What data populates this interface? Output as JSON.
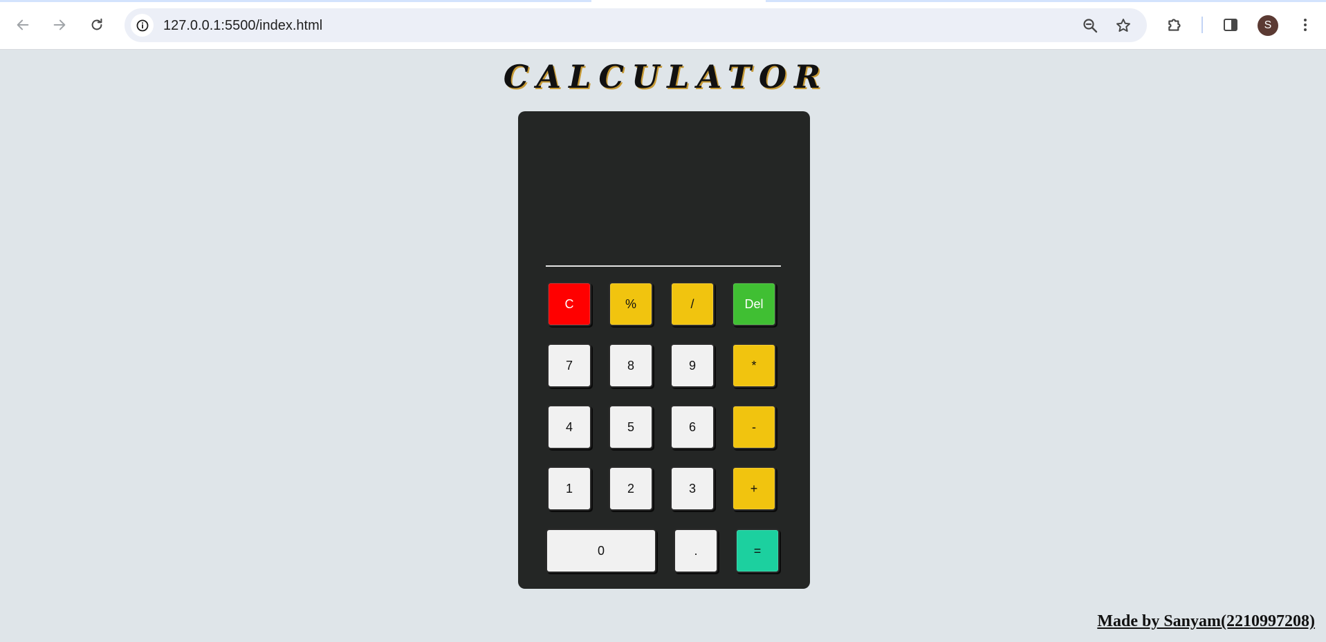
{
  "browser": {
    "url": "127.0.0.1:5500/index.html",
    "profile_initial": "S",
    "icons": {
      "back": "arrow-left-icon",
      "forward": "arrow-right-icon",
      "reload": "reload-icon",
      "site_info": "info-icon",
      "zoom": "zoom-out-icon",
      "bookmark": "star-icon",
      "extensions": "puzzle-icon",
      "side_panel": "side-panel-icon",
      "menu": "kebab-menu-icon"
    }
  },
  "page": {
    "title": "CALCULATOR",
    "display_value": "",
    "footer": "Made by Sanyam(2210997208)"
  },
  "keypad": {
    "row1": [
      "C",
      "%",
      "/",
      "Del"
    ],
    "row2": [
      "7",
      "8",
      "9",
      "*"
    ],
    "row3": [
      "4",
      "5",
      "6",
      "-"
    ],
    "row4": [
      "1",
      "2",
      "3",
      "+"
    ],
    "row5": [
      "0",
      ".",
      "="
    ]
  },
  "colors": {
    "page_background": "#dfe5e9",
    "calculator_body": "#242625",
    "key_light": "#f1f1f1",
    "key_operator": "#f1c40f",
    "key_clear": "#ff0000",
    "key_delete": "#40bf33",
    "key_equals": "#1cd09f"
  }
}
